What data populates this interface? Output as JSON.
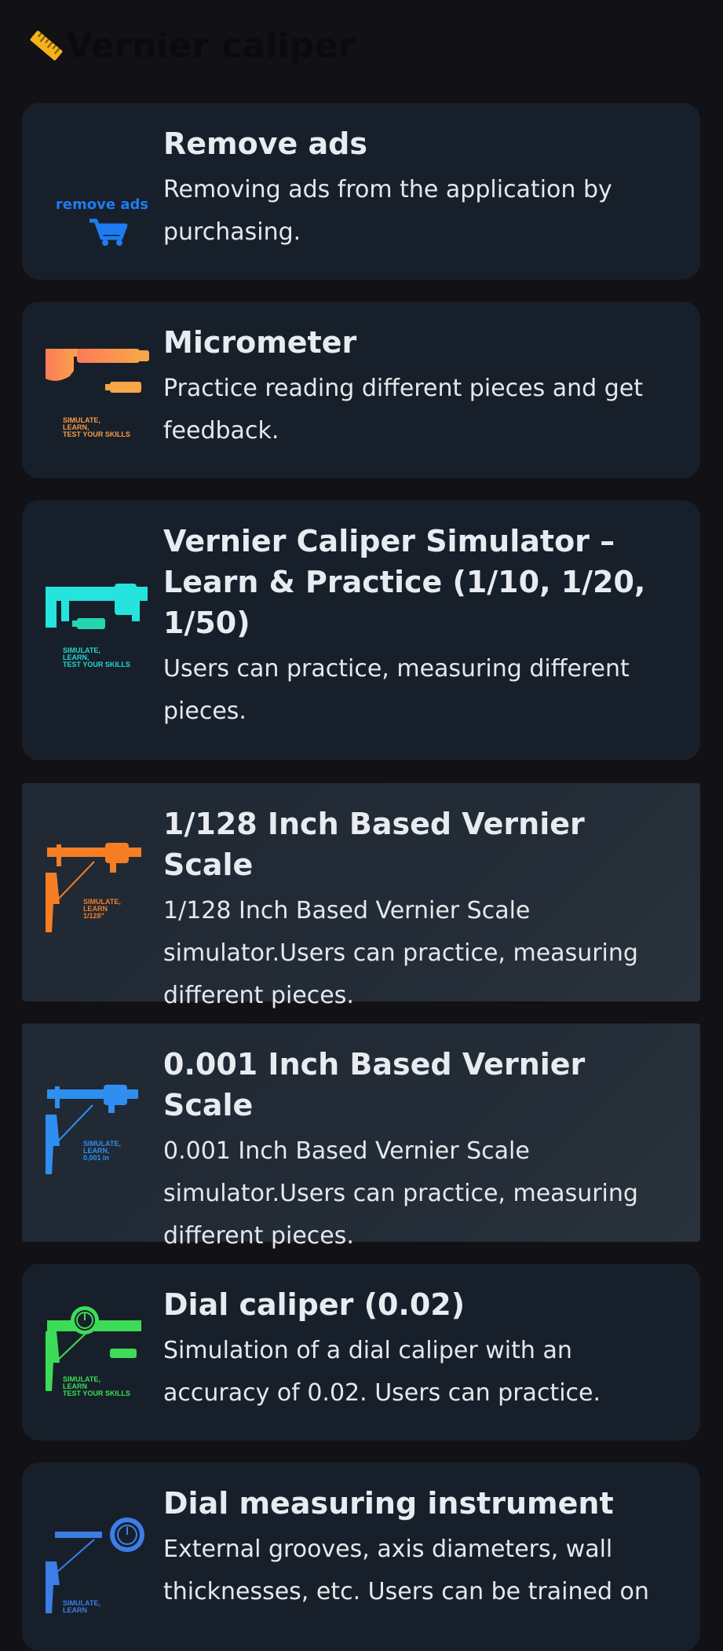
{
  "header": {
    "title": "Vernier caliper",
    "icon": "ruler-icon"
  },
  "items": [
    {
      "title": "Remove ads",
      "description": "Removing ads from the application by purchasing.",
      "thumb_label": "remove ads",
      "color": "#1e7cf2"
    },
    {
      "title": "Micrometer",
      "description": "Practice reading different pieces and get feedback.",
      "thumb_caption": "SIMULATE,\nLEARN,\nTEST YOUR SKILLS",
      "color": "#f79a4a"
    },
    {
      "title": "Vernier Caliper Simulator – Learn & Practice (1/10, 1/20, 1/50)",
      "description": "Users can practice, measuring different pieces.",
      "thumb_caption": "SIMULATE,\nLEARN,\nTEST YOUR SKILLS",
      "color": "#25d6d0"
    },
    {
      "title": "1/128 Inch Based Vernier Scale",
      "description": "1/128 Inch Based Vernier Scale simulator.Users can practice, measuring different pieces.",
      "thumb_caption": "SIMULATE,\nLEARN\n1/128\"",
      "color": "#f57d24"
    },
    {
      "title": "0.001 Inch Based Vernier Scale",
      "description": "0.001 Inch Based Vernier Scale simulator.Users can practice, measuring different pieces.",
      "thumb_caption": "SIMULATE,\nLEARN,\n0,001 in",
      "color": "#2f8ff0"
    },
    {
      "title": "Dial caliper (0.02)",
      "description": "Simulation of a dial caliper with an accuracy of 0.02. Users can practice.",
      "thumb_caption": "SIMULATE,\nLEARN\nTEST YOUR SKILLS",
      "color": "#3ddc58"
    },
    {
      "title": "Dial measuring instrument",
      "description": "External grooves, axis diameters, wall thicknesses, etc. Users can be trained on",
      "thumb_caption": "SIMULATE,\nLEARN",
      "color": "#3d7de8"
    }
  ]
}
